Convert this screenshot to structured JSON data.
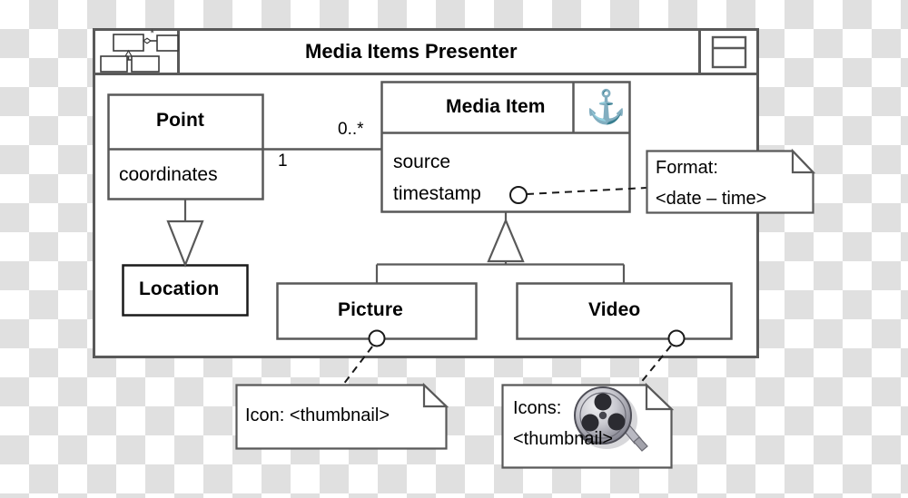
{
  "diagram": {
    "type": "uml-class-diagram",
    "frame_title": "Media Items Presenter",
    "header_icon_name": "class-diagram-icon",
    "header_right_icon_name": "class-box-icon",
    "stroke_color": "#595959",
    "dark_stroke_color": "#1a1a1a",
    "fill_color": "#ffffff"
  },
  "classes": [
    {
      "name": "Point",
      "attributes": [
        "coordinates"
      ]
    },
    {
      "name": "Media Item",
      "icon": "anchor-icon",
      "attributes": [
        "source",
        "timestamp"
      ]
    },
    {
      "name": "Location",
      "attributes": []
    },
    {
      "name": "Picture",
      "attributes": []
    },
    {
      "name": "Video",
      "attributes": []
    }
  ],
  "associations": [
    {
      "from": "Point",
      "to": "Media Item",
      "source_multiplicity": "1",
      "target_multiplicity": "0..*"
    }
  ],
  "generalizations": [
    {
      "parent": "Location",
      "child": "Point"
    },
    {
      "parent": "Media Item",
      "child": "Picture"
    },
    {
      "parent": "Media Item",
      "child": "Video"
    }
  ],
  "notes": [
    {
      "id": "format-note",
      "lines": [
        "Format:",
        "<date – time>"
      ],
      "attached_to": "timestamp"
    },
    {
      "id": "picture-icon-note",
      "lines": [
        "Icon: <thumbnail>"
      ],
      "attached_to": "Picture"
    },
    {
      "id": "video-icon-note",
      "lines": [
        "Icons:",
        "<thumbnail>"
      ],
      "attached_to": "Video",
      "image": "film-reel-icon"
    }
  ],
  "labels": {
    "frame_title": "Media Items Presenter",
    "point_title": "Point",
    "point_attr_coordinates": "coordinates",
    "media_item_title": "Media Item",
    "media_item_attr_source": "source",
    "media_item_attr_timestamp": "timestamp",
    "location_title": "Location",
    "picture_title": "Picture",
    "video_title": "Video",
    "mult_one": "1",
    "mult_many": "0..*",
    "format_note_line1": "Format:",
    "format_note_line2": "<date – time>",
    "picture_note_line1": "Icon: <thumbnail>",
    "video_note_line1": "Icons:",
    "video_note_line2": "<thumbnail>"
  }
}
